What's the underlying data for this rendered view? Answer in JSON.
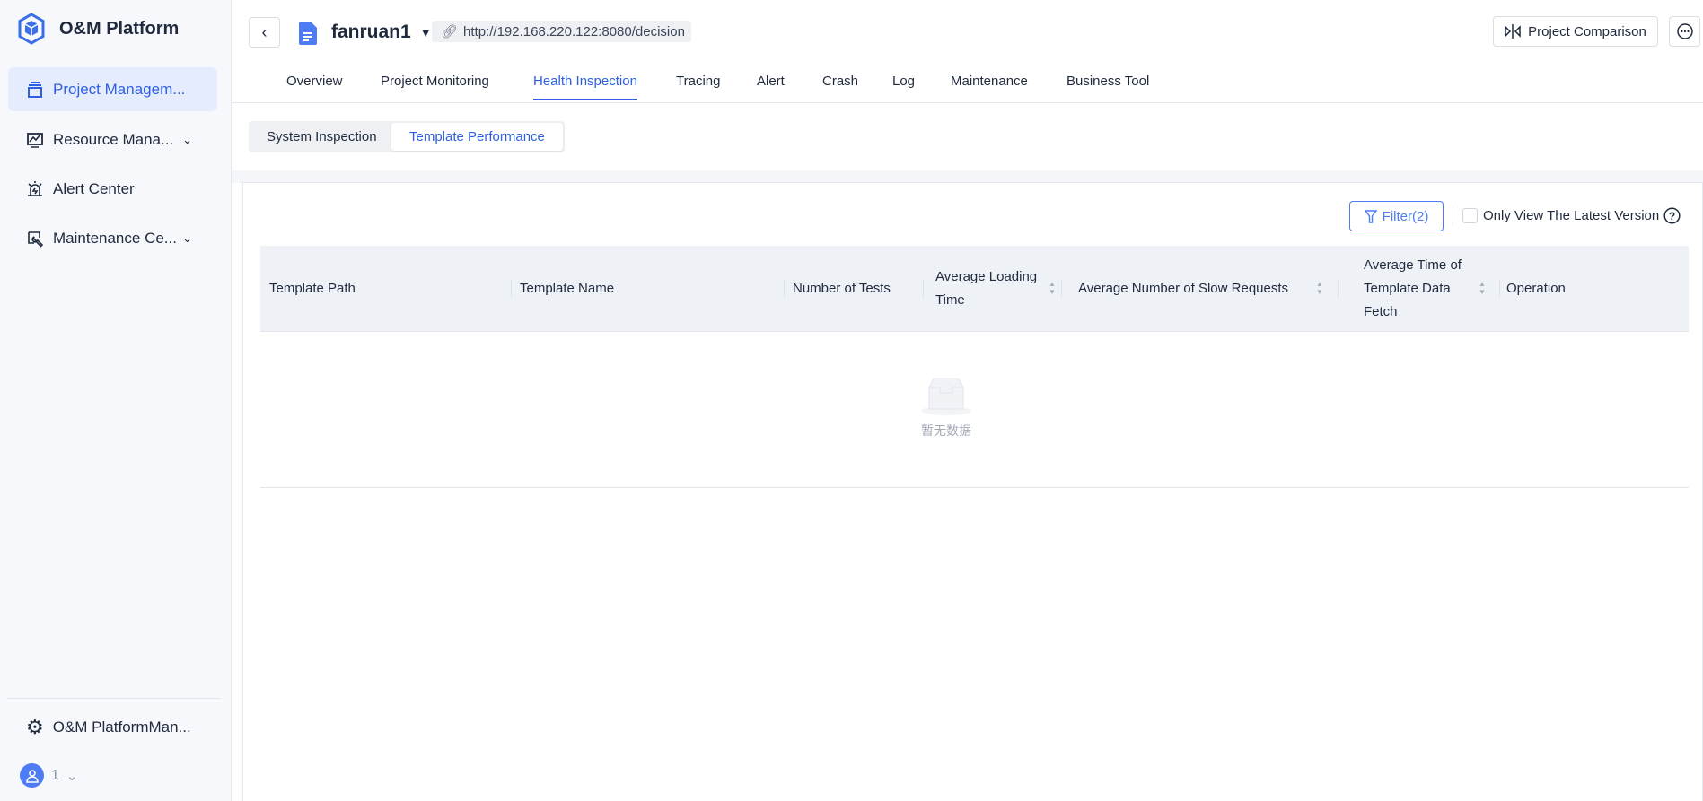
{
  "sidebar": {
    "brand": "O&M Platform",
    "items": [
      {
        "label": "Project Managem..."
      },
      {
        "label": "Resource Mana..."
      },
      {
        "label": "Alert Center"
      },
      {
        "label": "Maintenance Ce..."
      }
    ],
    "settings_label": "O&M PlatformMan...",
    "user_label": "1"
  },
  "header": {
    "project_name": "fanruan1",
    "url": "http://192.168.220.122:8080/decision",
    "compare_label": "Project Comparison"
  },
  "tabs": [
    "Overview",
    "Project Monitoring",
    "Health Inspection",
    "Tracing",
    "Alert",
    "Crash",
    "Log",
    "Maintenance",
    "Business Tool"
  ],
  "subtabs": [
    "System Inspection",
    "Template Performance"
  ],
  "toolbar": {
    "filter_label": "Filter(2)",
    "latest_label": "Only View The Latest Version",
    "latest_checked": false
  },
  "table": {
    "columns": [
      "Template Path",
      "Template Name",
      "Number of Tests",
      "Average Loading Time",
      "Average Number of Slow Requests",
      "Average Time of Template Data Fetch",
      "Operation"
    ],
    "empty_text": "暂无数据"
  },
  "colors": {
    "accent": "#2e5fe0",
    "sidebar_bg": "#f7f8fc"
  }
}
